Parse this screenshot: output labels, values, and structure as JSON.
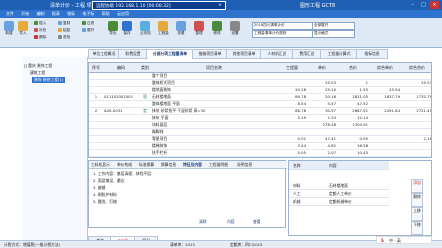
{
  "window": {
    "title": "清单计价 - 工程  项目/ 单位工程",
    "right_caption": "图形工程 GCT8"
  },
  "remote": {
    "label": "远程协助  192.168.1.10  [00:00:32]",
    "close": "×"
  },
  "menu": [
    "文件",
    "开始",
    "编制",
    "报表",
    "指标",
    "电子标",
    "帮助",
    "云应用"
  ],
  "ribbon": {
    "big_buttons": [
      "新建",
      "导入",
      "导出",
      "保存",
      "云存档",
      "工程量",
      "查看",
      "整理",
      "修改",
      "设置"
    ],
    "small_buttons": [
      "插入",
      "补充",
      "删除",
      "复制",
      "粘贴",
      "查找",
      "过滤",
      "展开"
    ],
    "combo_1": "2018四川清单计价",
    "combo_2": "工程量清单计价规则",
    "combo_3": "全部展开",
    "combo_4": "显示格式"
  },
  "tree": {
    "root": "[] 重庆 装饰工程",
    "child": "建筑工程",
    "selected": "装饰 装修工程(1)"
  },
  "tabs": [
    "单位工程概况",
    "取费设置",
    "分部分项工程量清单",
    "措施项目清单",
    "其他项目清单",
    "人材机汇总",
    "费用汇总",
    "工程量计算式",
    "指标信息"
  ],
  "grid": {
    "headers": [
      "序号",
      "编码",
      "类别",
      "项目名称",
      "工程量",
      "单价",
      "合价",
      "综合单价",
      "综合合价"
    ],
    "rows": [
      {
        "no": "",
        "code": "",
        "type": "",
        "name": "整个项目",
        "qty": "",
        "price": "",
        "total": "",
        "uprice": "",
        "utotal": ""
      },
      {
        "no": "",
        "code": "",
        "type": "",
        "name": "整体柜式项目",
        "qty": "",
        "price": "25.53",
        "total": "1",
        "uprice": "",
        "utotal": "25.53"
      },
      {
        "no": "",
        "code": "",
        "type": "",
        "name": "楼地面装饰",
        "qty": "20.28",
        "price": "25.10",
        "total": "1.55",
        "uprice": "25.54",
        "utotal": ""
      },
      {
        "no": "1",
        "code": "011102001001",
        "type": "项",
        "name": "石材楼地面",
        "qty": "89.78",
        "price": "20.16",
        "total": "1811.05",
        "uprice": "1837.79",
        "utotal": "1732.79"
      },
      {
        "no": "",
        "code": "",
        "type": "",
        "name": "整体楼地面 平面",
        "qty": "8.54",
        "price": "5.57",
        "total": "47.52",
        "uprice": "",
        "utotal": ""
      },
      {
        "no": "2",
        "code": "A20-0031",
        "type": "定",
        "name": "抹灰 砂浆找平 干混砂浆  厚=30",
        "qty": "86.78",
        "price": "30.97",
        "total": "2687.91",
        "uprice": "2491.84",
        "utotal": "2721.49"
      },
      {
        "no": "",
        "code": "",
        "type": "",
        "name": "抹灰 平面",
        "qty": "5.19",
        "price": "2.34",
        "total": "12.14",
        "uprice": "",
        "utotal": ""
      },
      {
        "no": "",
        "code": "",
        "type": "",
        "name": "块料面层",
        "qty": "",
        "price": "278.48",
        "total": "1304.91",
        "uprice": "",
        "utotal": ""
      },
      {
        "no": "",
        "code": "",
        "type": "",
        "name": "踢脚线",
        "qty": "",
        "price": "",
        "total": "",
        "uprice": "",
        "utotal": ""
      },
      {
        "no": "",
        "code": "",
        "type": "",
        "name": "零星项目",
        "qty": "0.02",
        "price": "47.41",
        "total": "0.95",
        "uprice": "",
        "utotal": "2.16"
      },
      {
        "no": "",
        "code": "",
        "type": "",
        "name": "楼梯装饰",
        "qty": "3.44",
        "price": "4.82",
        "total": "16.58",
        "uprice": "",
        "utotal": ""
      },
      {
        "no": "",
        "code": "",
        "type": "",
        "name": "扶手栏杆",
        "qty": "5.05",
        "price": "2.07",
        "total": "10.45",
        "uprice": "",
        "utotal": ""
      },
      {
        "no": "",
        "code": "",
        "type": "",
        "name": "台阶装饰",
        "qty": "5.08",
        "price": "",
        "total": "",
        "uprice": "",
        "utotal": ""
      },
      {
        "no": "3",
        "code": "011201001001",
        "type": "项",
        "name": "墙面一般抹灰",
        "qty": "",
        "price": "",
        "total": "",
        "uprice": "",
        "utotal": ""
      },
      {
        "no": "",
        "code": "",
        "type": "",
        "name": "合计",
        "qty": "1",
        "price": "",
        "total": "",
        "uprice": "40662.8",
        "utotal": "4.10"
      }
    ]
  },
  "bottom_panel": {
    "tabs": [
      "工料机显示",
      "单价构成",
      "标准换算",
      "换算信息",
      "特征及内容",
      "工程量明细",
      "说明信息"
    ],
    "lines": [
      "1. 工作内容：基层清理、抹找平层",
      "2. 面层铺设、磨边",
      "3. 嵌缝",
      "4. 刷防护材料",
      "5. 酸洗、打蜡"
    ],
    "buttons": [
      "清除",
      "内容",
      "查看"
    ]
  },
  "right_panel": {
    "header_name": "名称",
    "header_value": "内容",
    "rows": [
      {
        "name": "材料",
        "value": "石材楼地面"
      },
      {
        "name": "人工",
        "value": "定额人工单价"
      },
      {
        "name": "机械",
        "value": "定额机械单价"
      }
    ],
    "side_buttons": [
      "添加",
      "删除",
      "上移",
      "下移"
    ]
  },
  "bottom_tabs": [
    "查询",
    "工料机",
    "指引"
  ],
  "status": {
    "left": "计税方式：增值税(一般计税方法)",
    "mid": "清单库：2013",
    "right": "定额库：四川2015"
  },
  "ime": {
    "label": "中 · 英"
  }
}
